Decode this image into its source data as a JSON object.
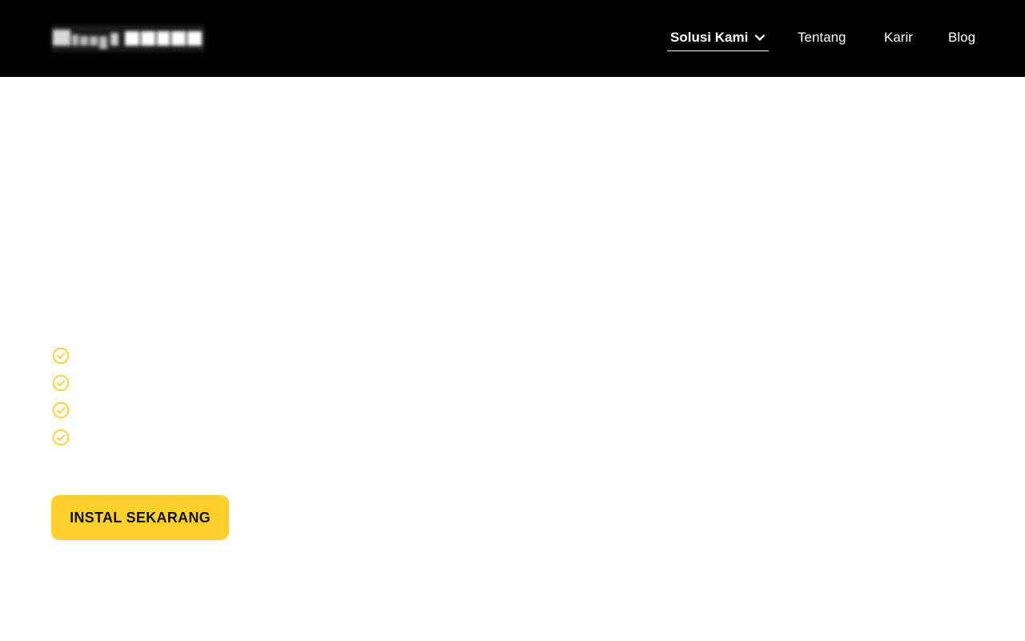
{
  "colors": {
    "header_bg": "#000000",
    "accent": "#FFD02B",
    "nav_text": "#FFFFFF",
    "cta_text": "#111111"
  },
  "header": {
    "logo_icon": "brand-logo-icon",
    "nav": {
      "items": [
        {
          "label": "Solusi Kami",
          "active": true,
          "icon": "chevron-down-icon"
        },
        {
          "label": "Tentang",
          "active": false
        },
        {
          "label": "Karir",
          "active": false
        },
        {
          "label": "Blog",
          "active": false
        }
      ]
    }
  },
  "features": {
    "icon": "check-circle-icon",
    "items": [
      "",
      "",
      "",
      ""
    ]
  },
  "cta": {
    "label": "INSTAL SEKARANG"
  }
}
